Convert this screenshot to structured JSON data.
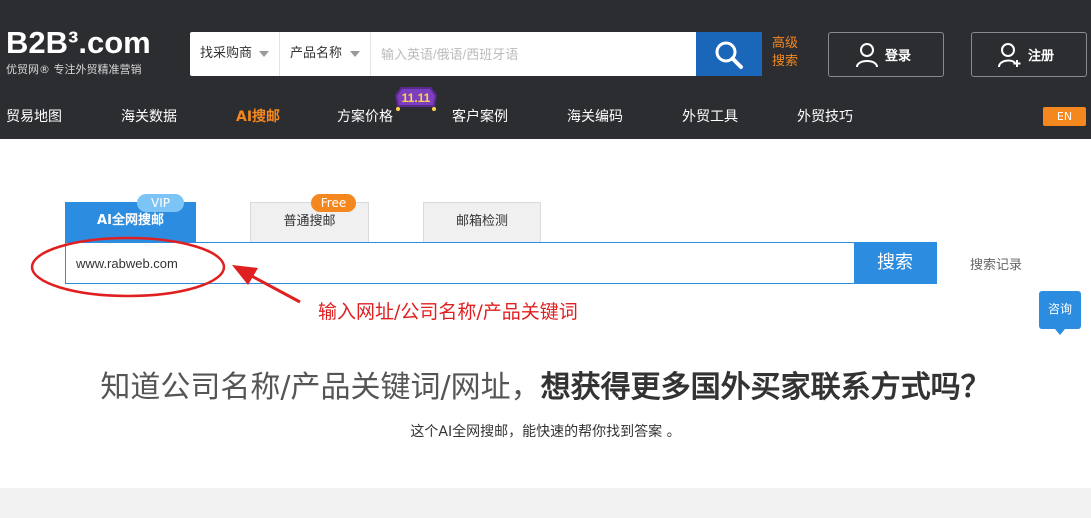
{
  "header": {
    "logo_main": "B2B³.com",
    "logo_sub": "优贸网® 专注外贸精准营销",
    "search": {
      "select1": "找采购商",
      "select2": "产品名称",
      "placeholder": "输入英语/俄语/西班牙语"
    },
    "advanced_search": "高级搜索",
    "login_label": "登录",
    "register_label": "注册"
  },
  "nav": {
    "items": [
      "贸易地图",
      "海关数据",
      "AI搜邮",
      "方案价格",
      "客户案例",
      "海关编码",
      "外贸工具",
      "外贸技巧"
    ],
    "active_index": 2,
    "badge": "11.11",
    "language": "EN"
  },
  "tabs": [
    {
      "label": "AI全网搜邮",
      "tag": "VIP"
    },
    {
      "label": "普通搜邮",
      "tag": "Free"
    },
    {
      "label": "邮箱检测"
    }
  ],
  "main_search": {
    "value": "www.rabweb.com",
    "button": "搜索",
    "history": "搜索记录"
  },
  "annotation": "输入网址/公司名称/产品关键词",
  "consult": "咨询",
  "headline": {
    "normal": "知道公司名称/产品关键词/网址，",
    "bold": "想获得更多国外买家联系方式吗？"
  },
  "subline": "这个AI全网搜邮，能快速的帮你找到答案 。",
  "colors": {
    "header_bg": "#2c2d31",
    "accent_orange": "#f5871f",
    "primary_blue": "#2b8ce0",
    "annotation_red": "#e02020"
  }
}
